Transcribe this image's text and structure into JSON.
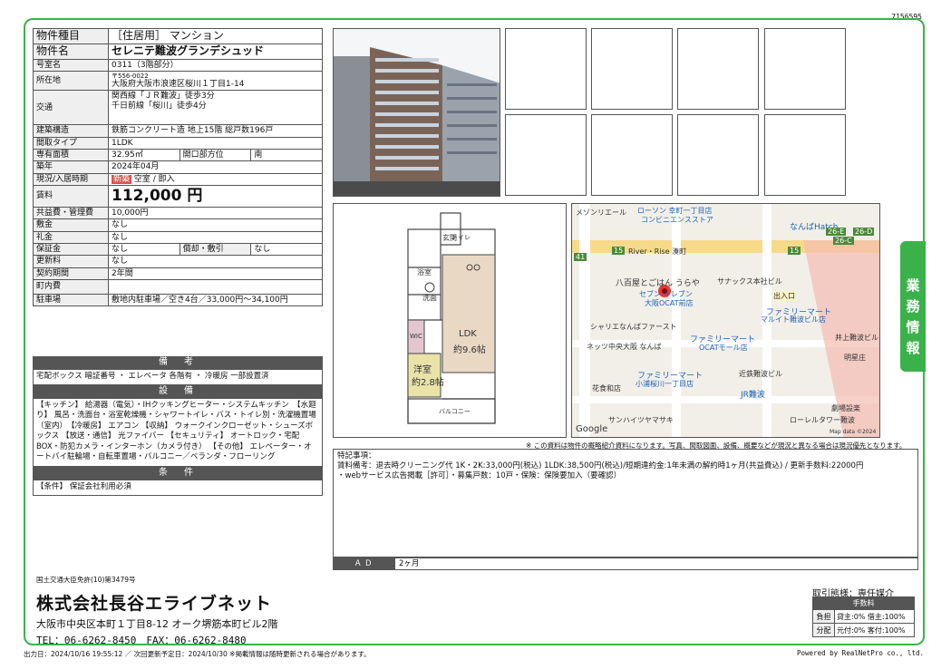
{
  "doc_id": "7156595",
  "property": {
    "rows": {
      "type": {
        "label": "物件種目",
        "value": "［住居用］ マンション"
      },
      "name": {
        "label": "物件名",
        "value": "セレニテ難波グランデシュッド"
      },
      "room": {
        "label": "号室名",
        "value": "0311（3階部分）"
      },
      "address": {
        "label": "所在地",
        "postal": "〒556-0022",
        "value": "大阪府大阪市浪速区桜川１丁目1-14"
      },
      "transport": {
        "label": "交通",
        "line1": "関西線「ＪＲ難波」徒歩3分",
        "line2": "千日前線「桜川」徒歩4分"
      },
      "structure": {
        "label": "建築構造",
        "value": "鉄筋コンクリート造 地上15階 総戸数196戸"
      },
      "layout": {
        "label": "間取タイプ",
        "value": "1LDK"
      },
      "area": {
        "label": "専有面積",
        "value": "32.95㎡",
        "dir_label": "開口部方位",
        "dir_value": "南"
      },
      "built": {
        "label": "築年",
        "value": "2024年04月"
      },
      "status": {
        "label": "現況/入居時期",
        "badge": "新築",
        "value": "空室 / 即入"
      },
      "rent": {
        "label": "賃料",
        "value": "112,000 円"
      },
      "mgmt": {
        "label": "共益費・管理費",
        "value": "10,000円"
      },
      "deposit": {
        "label": "敷金",
        "value": "なし"
      },
      "key_money": {
        "label": "礼金",
        "value": "なし"
      },
      "security": {
        "label": "保証金",
        "value": "なし",
        "sub_label": "償却・敷引",
        "sub_value": "なし"
      },
      "renewal": {
        "label": "更新料",
        "value": "なし"
      },
      "contract": {
        "label": "契約期間",
        "value": "2年間"
      },
      "town_fee": {
        "label": "町内費",
        "value": ""
      },
      "parking": {
        "label": "駐車場",
        "value": "敷地内駐車場／空き4台／33,000円～34,100円"
      }
    },
    "sections": {
      "equipment_head": "備　考",
      "equipment_body": "宅配ボックス 暗証番号 ・ エレベータ 各階有 ・ 冷暖房 一部設置済",
      "facility_head": "設　備",
      "facility_body": "【キッチン】 給湯器（電気）・IHクッキングヒーター・システムキッチン　【水廻り】 風呂・洗面台・浴室乾燥機・シャワートイレ・バス・トイレ別・洗濯機置場（室内）　【冷暖房】 エアコン 【収納】 ウォークインクローゼット・シューズボックス 【放送・通信】 光ファイバー 【セキュリティ】 オートロック・宅配BOX・防犯カメラ・インターホン（カメラ付き） 【その他】 エレベーター・オートバイ駐輪場・自転車置場・バルコニー／ベランダ・フローリング",
      "cond_head": "条　件",
      "cond_body": "【条件】 保証会社利用必須"
    }
  },
  "floorplan": {
    "genkan": "玄関",
    "bath": "浴室",
    "wash": "洗面",
    "toilet": "トイレ",
    "wic": "WIC",
    "ldk": "LDK",
    "ldk_size": "約9.6帖",
    "western": "洋室",
    "western_size": "約2.8帖",
    "balcony": "バルコニー"
  },
  "map": {
    "labels": [
      "ローソン 幸町一丁目店",
      "コンビニエンスストア",
      "メゾンリエール",
      "なんばHatch",
      "River・Rise 湊町",
      "八百屋とごはん うらや",
      "サナックス本社ビル",
      "セブン-イレブン",
      "大阪OCAT前店",
      "シャリエなんばファースト",
      "ファミリーマート",
      "マルイト難波ビル店",
      "ネッツ中央大阪 なんば",
      "ファミリーマート",
      "OCATモール店",
      "井上難波ビル",
      "ファミリーマート",
      "小浦桜川一丁目店",
      "近鉄難波ビル",
      "JR難波",
      "花食和店",
      "サンハイツヤマサキ",
      "ローレルタワー難波",
      "出入口",
      "明星庄",
      "劇場設楽",
      "Google",
      "Map data ©2024"
    ],
    "route_badges": [
      "26-E",
      "26-D",
      "26-C",
      "15",
      "41",
      "15"
    ]
  },
  "notice": "※ この資料は物件の概略紹介資料になります。写真、間取図面、設備、概要などが現況と異なる場合は現況優先となります。",
  "special": {
    "title": "特記事項：",
    "line1": "賃料備考：退去時クリーニング代 1K・2K:33,000円(税込) 1LDK:38,500円(税込)/短期違約金:1年未満の解約時1ヶ月(共益費込) / 更新手数料:22000円",
    "line2": "・webサービス広告掲載［許可］・募集戸数：10戸・保険：保険要加入（要確認）"
  },
  "ad": {
    "label": "ＡＤ",
    "value": "2ヶ月"
  },
  "side_tab": [
    "業",
    "務",
    "情",
    "報"
  ],
  "company": {
    "license": "国土交通大臣免許(10)第3479号",
    "name": "株式会社長谷エライブネット",
    "address": "大阪市中央区本町１丁目8-12 オーク堺筋本町ビル2階",
    "tel": "TEL：06-6262-8450　FAX：06-6262-8480"
  },
  "deal": {
    "label": "取引態様：専任媒介",
    "fee_head": "手数料",
    "burden_label": "負担",
    "burden_value": "貸主:0% 借主:100%",
    "split_label": "分配",
    "split_value": "元付:0% 客付:100%"
  },
  "footer": {
    "left": "出力日：2024/10/16 19:55:12 ／ 次回更新予定日：2024/10/30 ※掲載情報は随時更新される場合があります。",
    "right": "Powered by RealNetPro co., ltd."
  }
}
